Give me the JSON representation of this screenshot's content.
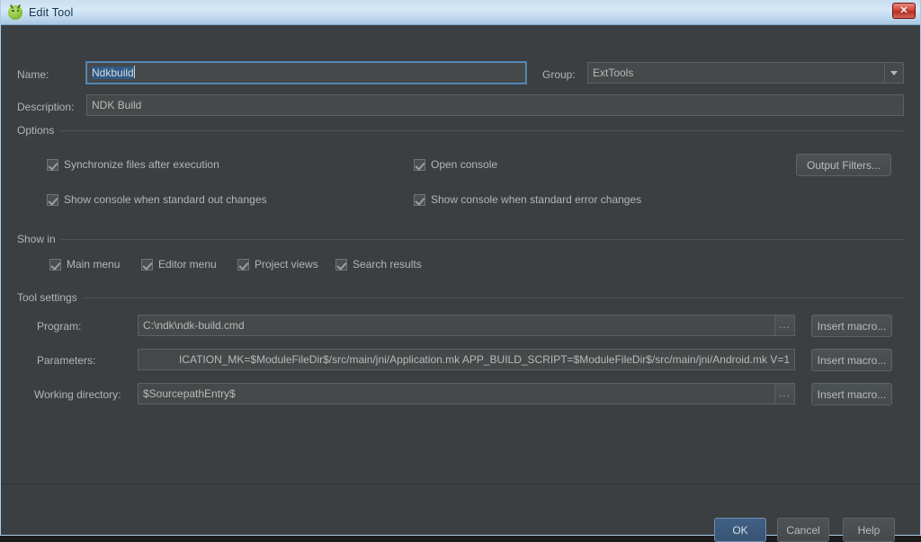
{
  "window": {
    "title": "Edit Tool",
    "icon": "android-tool-icon",
    "close_label": "✕",
    "border_color": "#a8cde8",
    "background_color": "#3c3f41"
  },
  "form": {
    "name": {
      "label": "Name:",
      "value": "Ndkbuild",
      "focused": true,
      "selected": true
    },
    "group": {
      "label": "Group:",
      "value": "ExtTools"
    },
    "description": {
      "label": "Description:",
      "value": "NDK Build"
    }
  },
  "options": {
    "title": "Options",
    "checkboxes": [
      {
        "label": "Synchronize files after execution",
        "checked": true
      },
      {
        "label": "Open console",
        "checked": true
      },
      {
        "label": "Show console when standard out changes",
        "checked": true
      },
      {
        "label": "Show console when standard error changes",
        "checked": true
      }
    ],
    "output_filters_button": "Output Filters..."
  },
  "show_in": {
    "title": "Show in",
    "checkboxes": [
      {
        "label": "Main menu",
        "checked": true
      },
      {
        "label": "Editor menu",
        "checked": true
      },
      {
        "label": "Project views",
        "checked": true
      },
      {
        "label": "Search results",
        "checked": true
      }
    ]
  },
  "tool_settings": {
    "title": "Tool settings",
    "program": {
      "label": "Program:",
      "value": "C:\\ndk\\ndk-build.cmd",
      "browse_label": "...",
      "macro_button": "Insert macro..."
    },
    "parameters": {
      "label": "Parameters:",
      "value": "ICATION_MK=$ModuleFileDir$/src/main/jni/Application.mk APP_BUILD_SCRIPT=$ModuleFileDir$/src/main/jni/Android.mk V=1",
      "macro_button": "Insert macro..."
    },
    "working_directory": {
      "label": "Working directory:",
      "value": "$SourcepathEntry$",
      "browse_label": "...",
      "macro_button": "Insert macro..."
    }
  },
  "footer": {
    "ok": "OK",
    "cancel": "Cancel",
    "help": "Help"
  }
}
